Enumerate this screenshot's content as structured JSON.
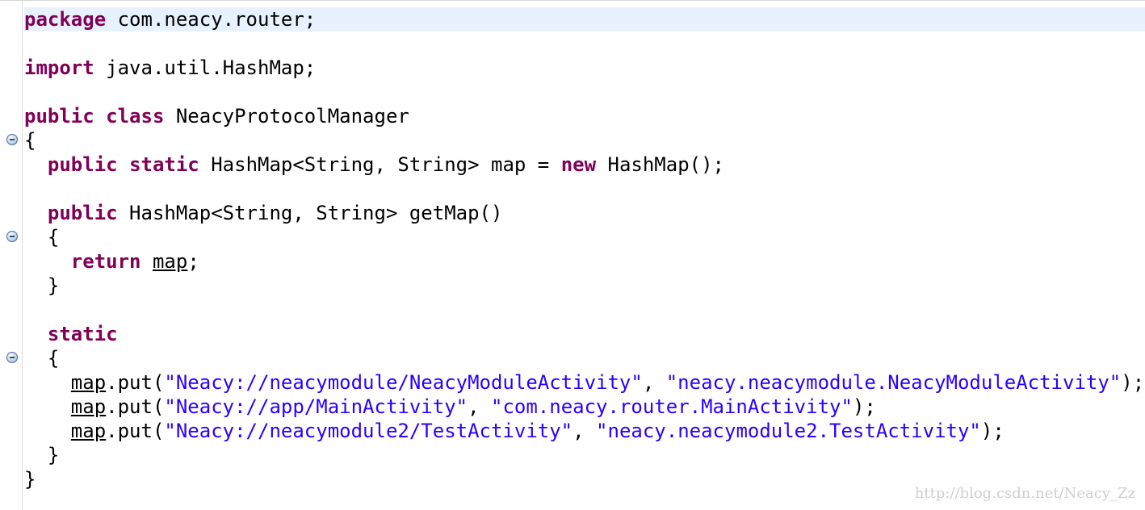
{
  "editor": {
    "lines": [
      [
        "package",
        " com.neacy.router;"
      ],
      [
        "import",
        " java.util.HashMap;"
      ],
      [
        "public",
        "class",
        " NeacyProtocolManager"
      ],
      [
        "{"
      ],
      [
        "public",
        "static",
        " HashMap<String, String> map = ",
        "new",
        " HashMap();"
      ],
      [
        "public",
        " HashMap<String, String> getMap()"
      ],
      [
        "{"
      ],
      [
        "return",
        "map",
        ";"
      ],
      [
        "}"
      ],
      [
        "static"
      ],
      [
        "{"
      ],
      [
        "map",
        ".put(",
        "\"Neacy://neacymodule/NeacyModuleActivity\"",
        ", ",
        "\"neacy.neacymodule.NeacyModuleActivity\"",
        ");"
      ],
      [
        "map",
        ".put(",
        "\"Neacy://app/MainActivity\"",
        ", ",
        "\"com.neacy.router.MainActivity\"",
        ");"
      ],
      [
        "map",
        ".put(",
        "\"Neacy://neacymodule2/TestActivity\"",
        ", ",
        "\"neacy.neacymodule2.TestActivity\"",
        ");"
      ],
      [
        "}"
      ],
      [
        "}"
      ]
    ]
  },
  "watermark": "http://blog.csdn.net/Neacy_Zz",
  "colors": {
    "keyword": "#7f0055",
    "string": "#2a00ff",
    "text": "#000000",
    "current_line": "#e8f2fe"
  },
  "icons": {
    "fold": "collapse-minus-icon"
  }
}
